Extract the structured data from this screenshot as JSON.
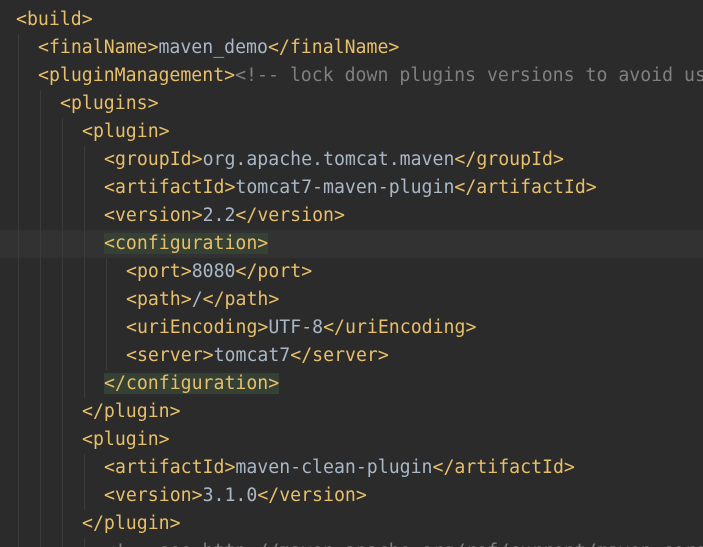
{
  "theme": {
    "background": "#2b2b2b",
    "current_line": "#323232",
    "tag": "#e8bf6a",
    "text": "#a9b7c6",
    "comment": "#808080",
    "tag_match_highlight": "#344134"
  },
  "lines": [
    {
      "indent": 0,
      "current": false,
      "tokens": [
        {
          "t": "tag",
          "v": "<build>"
        }
      ]
    },
    {
      "indent": 1,
      "current": false,
      "tokens": [
        {
          "t": "tag",
          "v": "<finalName>"
        },
        {
          "t": "txt",
          "v": "maven_demo"
        },
        {
          "t": "tag",
          "v": "</finalName>"
        }
      ]
    },
    {
      "indent": 1,
      "current": false,
      "tokens": [
        {
          "t": "tag",
          "v": "<pluginManagement>"
        },
        {
          "t": "cmt",
          "v": "<!-- lock down plugins versions to avoid us"
        }
      ]
    },
    {
      "indent": 2,
      "current": false,
      "tokens": [
        {
          "t": "tag",
          "v": "<plugins>"
        }
      ]
    },
    {
      "indent": 3,
      "current": false,
      "tokens": [
        {
          "t": "tag",
          "v": "<plugin>"
        }
      ]
    },
    {
      "indent": 4,
      "current": false,
      "tokens": [
        {
          "t": "tag",
          "v": "<groupId>"
        },
        {
          "t": "txt",
          "v": "org.apache.tomcat.maven"
        },
        {
          "t": "tag",
          "v": "</groupId>"
        }
      ]
    },
    {
      "indent": 4,
      "current": false,
      "tokens": [
        {
          "t": "tag",
          "v": "<artifactId>"
        },
        {
          "t": "txt",
          "v": "tomcat7-maven-plugin"
        },
        {
          "t": "tag",
          "v": "</artifactId>"
        }
      ]
    },
    {
      "indent": 4,
      "current": false,
      "tokens": [
        {
          "t": "tag",
          "v": "<version>"
        },
        {
          "t": "txt",
          "v": "2.2"
        },
        {
          "t": "tag",
          "v": "</version>"
        }
      ]
    },
    {
      "indent": 4,
      "current": true,
      "tokens": [
        {
          "t": "tag",
          "v": "<configuration>",
          "match": true
        }
      ]
    },
    {
      "indent": 5,
      "current": false,
      "tokens": [
        {
          "t": "tag",
          "v": "<port>"
        },
        {
          "t": "txt",
          "v": "8080"
        },
        {
          "t": "tag",
          "v": "</port>"
        }
      ]
    },
    {
      "indent": 5,
      "current": false,
      "tokens": [
        {
          "t": "tag",
          "v": "<path>"
        },
        {
          "t": "txt",
          "v": "/"
        },
        {
          "t": "tag",
          "v": "</path>"
        }
      ]
    },
    {
      "indent": 5,
      "current": false,
      "tokens": [
        {
          "t": "tag",
          "v": "<uriEncoding>"
        },
        {
          "t": "txt",
          "v": "UTF-8"
        },
        {
          "t": "tag",
          "v": "</uriEncoding>"
        }
      ]
    },
    {
      "indent": 5,
      "current": false,
      "tokens": [
        {
          "t": "tag",
          "v": "<server>"
        },
        {
          "t": "txt",
          "v": "tomcat7"
        },
        {
          "t": "tag",
          "v": "</server>"
        }
      ]
    },
    {
      "indent": 4,
      "current": false,
      "tokens": [
        {
          "t": "tag",
          "v": "</configuration>",
          "match": true
        }
      ]
    },
    {
      "indent": 3,
      "current": false,
      "tokens": [
        {
          "t": "tag",
          "v": "</plugin>"
        }
      ]
    },
    {
      "indent": 3,
      "current": false,
      "tokens": [
        {
          "t": "tag",
          "v": "<plugin>"
        }
      ]
    },
    {
      "indent": 4,
      "current": false,
      "tokens": [
        {
          "t": "tag",
          "v": "<artifactId>"
        },
        {
          "t": "txt",
          "v": "maven-clean-plugin"
        },
        {
          "t": "tag",
          "v": "</artifactId>"
        }
      ]
    },
    {
      "indent": 4,
      "current": false,
      "tokens": [
        {
          "t": "tag",
          "v": "<version>"
        },
        {
          "t": "txt",
          "v": "3.1.0"
        },
        {
          "t": "tag",
          "v": "</version>"
        }
      ]
    },
    {
      "indent": 3,
      "current": false,
      "tokens": [
        {
          "t": "tag",
          "v": "</plugin>"
        }
      ]
    },
    {
      "indent": 4,
      "current": false,
      "tokens": [
        {
          "t": "cmt",
          "v": "<!-- see http://maven.apache.org/ref/current/maven-core/"
        }
      ]
    }
  ]
}
